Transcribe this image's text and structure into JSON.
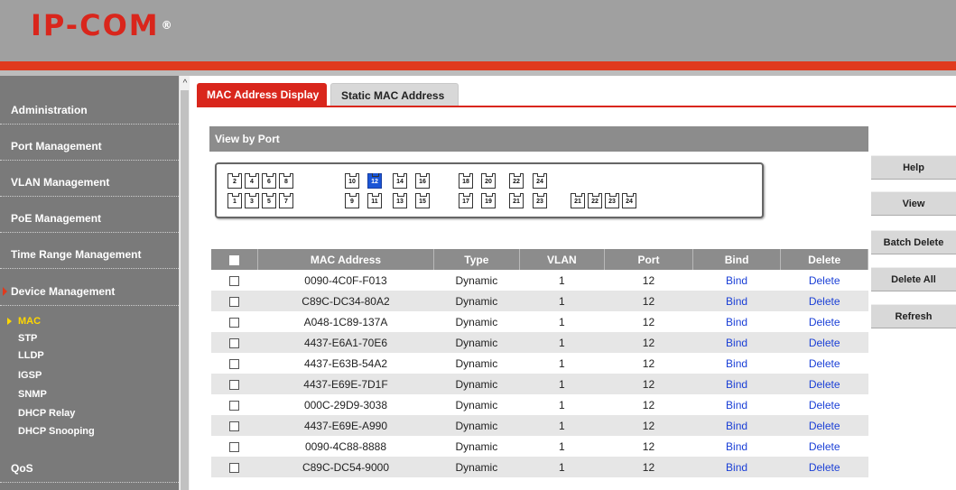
{
  "header": {
    "logo": "IP-COM",
    "logo_mark": "®"
  },
  "sidebar": {
    "items": [
      {
        "label": "Administration"
      },
      {
        "label": "Port Management"
      },
      {
        "label": "VLAN Management"
      },
      {
        "label": "PoE Management"
      },
      {
        "label": "Time Range Management"
      },
      {
        "label": "Device Management"
      }
    ],
    "subitems": [
      {
        "label": "MAC"
      },
      {
        "label": "STP"
      },
      {
        "label": "LLDP"
      },
      {
        "label": "IGSP"
      },
      {
        "label": "SNMP"
      },
      {
        "label": "DHCP Relay"
      },
      {
        "label": "DHCP Snooping"
      }
    ],
    "bottom_item": {
      "label": "QoS"
    }
  },
  "tabs": [
    {
      "label": "MAC Address Display",
      "active": true
    },
    {
      "label": "Static MAC Address",
      "active": false
    }
  ],
  "view_by_port": {
    "title": "View by Port",
    "ports_top_row": [
      "2",
      "4",
      "6",
      "8",
      "10",
      "12",
      "14",
      "16",
      "18",
      "20",
      "22",
      "24"
    ],
    "ports_bottom_row": [
      "1",
      "3",
      "5",
      "7",
      "9",
      "11",
      "13",
      "15",
      "17",
      "19",
      "21",
      "23"
    ],
    "sfp_ports": [
      "21",
      "22",
      "23",
      "24"
    ],
    "selected_port": "12"
  },
  "table": {
    "columns": [
      "MAC Address",
      "Type",
      "VLAN",
      "Port",
      "Bind",
      "Delete"
    ],
    "rows": [
      {
        "mac": "0090-4C0F-F013",
        "type": "Dynamic",
        "vlan": "1",
        "port": "12",
        "bind": "Bind",
        "delete": "Delete"
      },
      {
        "mac": "C89C-DC34-80A2",
        "type": "Dynamic",
        "vlan": "1",
        "port": "12",
        "bind": "Bind",
        "delete": "Delete"
      },
      {
        "mac": "A048-1C89-137A",
        "type": "Dynamic",
        "vlan": "1",
        "port": "12",
        "bind": "Bind",
        "delete": "Delete"
      },
      {
        "mac": "4437-E6A1-70E6",
        "type": "Dynamic",
        "vlan": "1",
        "port": "12",
        "bind": "Bind",
        "delete": "Delete"
      },
      {
        "mac": "4437-E63B-54A2",
        "type": "Dynamic",
        "vlan": "1",
        "port": "12",
        "bind": "Bind",
        "delete": "Delete"
      },
      {
        "mac": "4437-E69E-7D1F",
        "type": "Dynamic",
        "vlan": "1",
        "port": "12",
        "bind": "Bind",
        "delete": "Delete"
      },
      {
        "mac": "000C-29D9-3038",
        "type": "Dynamic",
        "vlan": "1",
        "port": "12",
        "bind": "Bind",
        "delete": "Delete"
      },
      {
        "mac": "4437-E69E-A990",
        "type": "Dynamic",
        "vlan": "1",
        "port": "12",
        "bind": "Bind",
        "delete": "Delete"
      },
      {
        "mac": "0090-4C88-8888",
        "type": "Dynamic",
        "vlan": "1",
        "port": "12",
        "bind": "Bind",
        "delete": "Delete"
      },
      {
        "mac": "C89C-DC54-9000",
        "type": "Dynamic",
        "vlan": "1",
        "port": "12",
        "bind": "Bind",
        "delete": "Delete"
      }
    ]
  },
  "side_buttons": [
    {
      "label": "Help"
    },
    {
      "label": "View"
    },
    {
      "label": "Batch Delete"
    },
    {
      "label": "Delete All"
    },
    {
      "label": "Refresh"
    }
  ],
  "colors": {
    "accent": "#d9261c",
    "sidebar": "#7a7a7a",
    "header": "#a0a0a0",
    "selected_port": "#1a55d6",
    "link": "#1a3fd6"
  },
  "icons": {
    "scroll_up": "chevron-up-icon",
    "menu_arrow": "triangle-right-icon"
  }
}
